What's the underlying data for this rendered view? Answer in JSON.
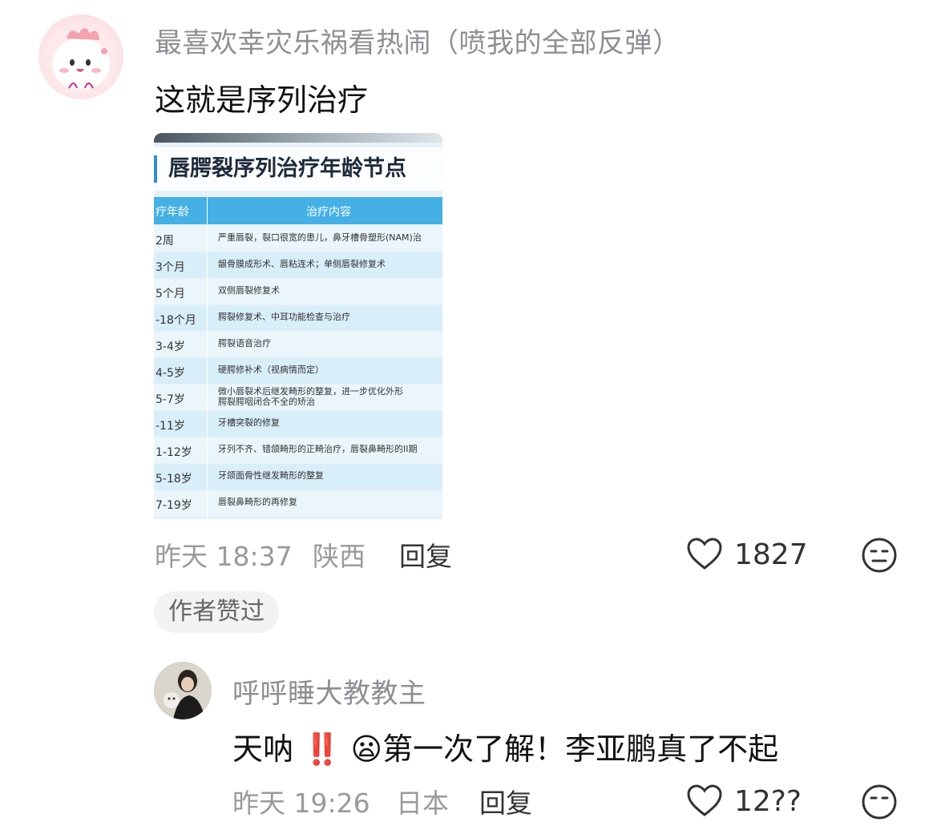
{
  "comment1": {
    "username": "最喜欢幸灾乐祸看热闹（喷我的全部反弹）",
    "text": "这就是序列治疗",
    "time": "昨天 18:37",
    "location": "陕西",
    "reply_label": "回复",
    "like_count": "1827",
    "badge": "作者赞过"
  },
  "image": {
    "title": "唇腭裂序列治疗年龄节点",
    "header_age": "疗年龄",
    "header_content": "治疗内容",
    "rows": [
      {
        "age": "2周",
        "content": "严重唇裂，裂口很宽的患儿，鼻牙槽骨塑形(NAM)治"
      },
      {
        "age": "3个月",
        "content": "龈骨膜成形术、唇粘连术；单侧唇裂修复术"
      },
      {
        "age": "5个月",
        "content": "双侧唇裂修复术"
      },
      {
        "age": "-18个月",
        "content": "腭裂修复术、中耳功能检查与治疗"
      },
      {
        "age": "3-4岁",
        "content": "腭裂语音治疗"
      },
      {
        "age": "4-5岁",
        "content": "硬腭修补术（视病情而定）"
      },
      {
        "age": "5-7岁",
        "content": "微小唇裂术后继发畸形的整复，进一步优化外形\n腭裂腭咽闭合不全的矫治"
      },
      {
        "age": "-11岁",
        "content": "牙槽突裂的修复"
      },
      {
        "age": "1-12岁",
        "content": "牙列不齐、错颌畸形的正畸治疗，唇裂鼻畸形的II期"
      },
      {
        "age": "5-18岁",
        "content": "牙颌面骨性继发畸形的整复"
      },
      {
        "age": "7-19岁",
        "content": "唇裂鼻畸形的再修复"
      }
    ]
  },
  "comment2": {
    "username": "呼呼睡大教教主",
    "text_part1": "天呐",
    "emoji1": "‼️",
    "emoji2": "😦",
    "text_part2": "第一次了解！李亚鹏真了不起",
    "time": "昨天 19:26",
    "location": "日本",
    "reply_label": "回复",
    "like_count": "12??"
  },
  "icons": {
    "like": "heart-outline-icon",
    "dislike": "meh-face-icon"
  }
}
